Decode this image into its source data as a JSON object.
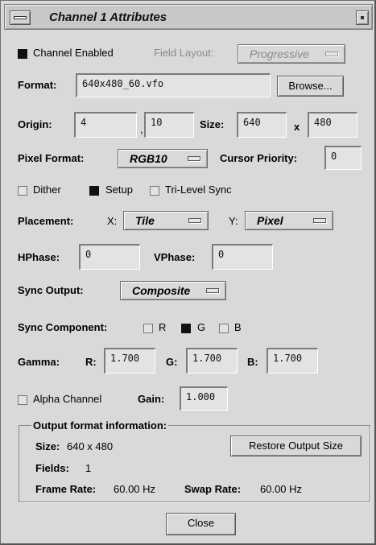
{
  "window": {
    "title": "Channel 1 Attributes"
  },
  "channel": {
    "enabled_label": "Channel Enabled",
    "enabled": true,
    "field_layout_label": "Field Layout:",
    "field_layout_value": "Progressive"
  },
  "format": {
    "label": "Format:",
    "value": "640x480_60.vfo",
    "browse_label": "Browse..."
  },
  "origin": {
    "label": "Origin:",
    "x": "4",
    "separator": ",",
    "y": "10"
  },
  "size": {
    "label": "Size:",
    "width": "640",
    "x_label": "x",
    "height": "480"
  },
  "pixel_format": {
    "label": "Pixel Format:",
    "value": "RGB10"
  },
  "cursor_priority": {
    "label": "Cursor Priority:",
    "value": "0"
  },
  "options": {
    "dither_label": "Dither",
    "dither": false,
    "setup_label": "Setup",
    "setup": true,
    "trilevel_label": "Tri-Level Sync",
    "trilevel": false
  },
  "placement": {
    "label": "Placement:",
    "x_label": "X:",
    "x_value": "Tile",
    "y_label": "Y:",
    "y_value": "Pixel"
  },
  "phase": {
    "hphase_label": "HPhase:",
    "hphase": "0",
    "vphase_label": "VPhase:",
    "vphase": "0"
  },
  "sync_output": {
    "label": "Sync Output:",
    "value": "Composite"
  },
  "sync_component": {
    "label": "Sync Component:",
    "r_label": "R",
    "r": false,
    "g_label": "G",
    "g": true,
    "b_label": "B",
    "b": false
  },
  "gamma": {
    "label": "Gamma:",
    "r_label": "R:",
    "r": "1.700",
    "g_label": "G:",
    "g": "1.700",
    "b_label": "B:",
    "b": "1.700"
  },
  "alpha": {
    "label": "Alpha Channel",
    "enabled": false,
    "gain_label": "Gain:",
    "gain": "1.000"
  },
  "output_info": {
    "title": "Output format information:",
    "size_label": "Size:",
    "size_value": "640 x 480",
    "restore_label": "Restore Output Size",
    "fields_label": "Fields:",
    "fields_value": "1",
    "frame_rate_label": "Frame Rate:",
    "frame_rate_value": "60.00 Hz",
    "swap_rate_label": "Swap Rate:",
    "swap_rate_value": "60.00 Hz"
  },
  "close_label": "Close"
}
